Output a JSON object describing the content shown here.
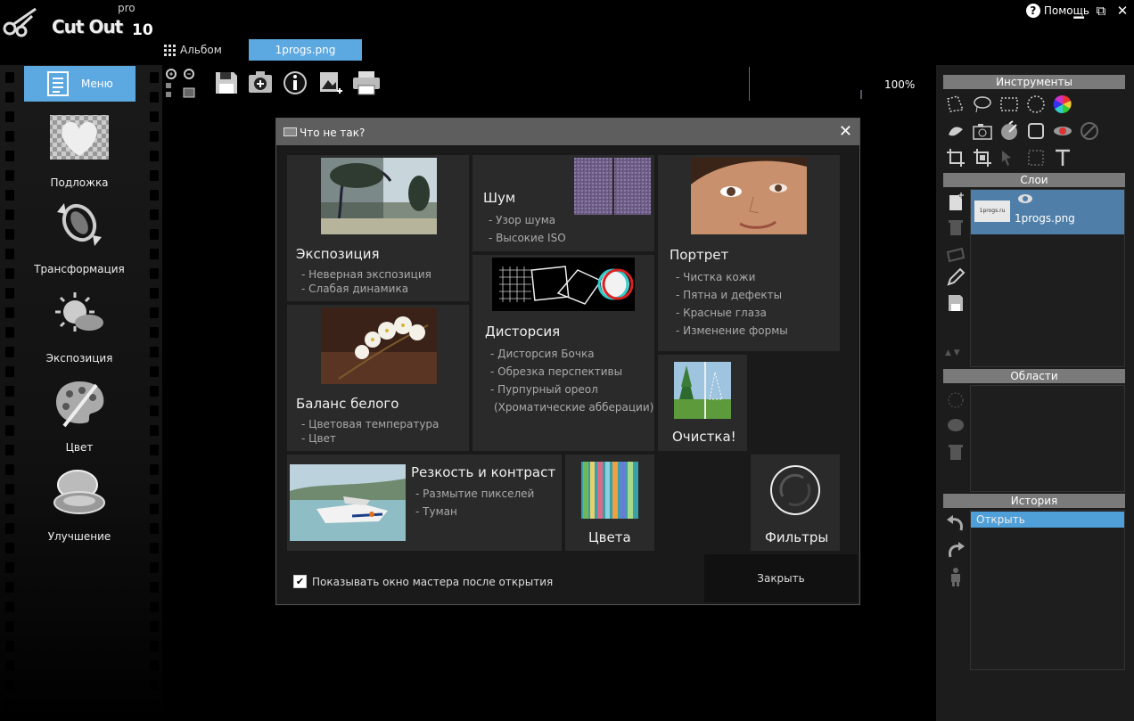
{
  "app": {
    "logo_text": "Cut Out",
    "logo_pro": "pro",
    "logo_version": "10"
  },
  "tabs": [
    {
      "label": "Альбом"
    },
    {
      "label": "1progs.png"
    }
  ],
  "window": {
    "help_label": "Помощь",
    "minimize": "▁",
    "maximize": "⧉",
    "close": "✕"
  },
  "sidebar": {
    "menu_label": "Меню",
    "items": [
      {
        "label": "Подложка",
        "icon": "heart-icon"
      },
      {
        "label": "Трансформация",
        "icon": "transform-icon"
      },
      {
        "label": "Экспозиция",
        "icon": "exposure-icon"
      },
      {
        "label": "Цвет",
        "icon": "palette-icon"
      },
      {
        "label": "Улучшение",
        "icon": "compact-icon"
      }
    ]
  },
  "toolbar": {
    "zoom": "100%",
    "icons": [
      "zoom-in-icon",
      "zoom-out-icon",
      "save-icon",
      "add-icon",
      "info-icon",
      "export-icon",
      "print-icon"
    ]
  },
  "right": {
    "tools_header": "Инструменты",
    "layers_header": "Слои",
    "layer": {
      "name": "1progs.png",
      "thumb_text": "1progs.ru"
    },
    "areas_header": "Области",
    "history_header": "История",
    "history_items": [
      "Открыть"
    ]
  },
  "dialog": {
    "title": "Что не так?",
    "close_symbol": "✕",
    "tiles": {
      "exposure": {
        "title": "Экспозиция",
        "items": [
          "- Неверная экспозиция",
          "- Слабая динамика"
        ]
      },
      "noise": {
        "title": "Шум",
        "items": [
          "- Узор шума",
          "- Высокие ISO"
        ]
      },
      "portrait": {
        "title": "Портрет",
        "items": [
          "- Чистка кожи",
          "- Пятна и дефекты",
          "- Красные глаза",
          "- Изменение формы"
        ]
      },
      "distortion": {
        "title": "Дисторсия",
        "items": [
          "- Дисторсия Бочка",
          "- Обрезка перспективы",
          "- Пурпурный ореол",
          "(Хроматические абберации)"
        ]
      },
      "white_balance": {
        "title": "Баланс белого",
        "items": [
          "- Цветовая температура",
          "- Цвет"
        ]
      },
      "cleanup": {
        "title": "Очистка!"
      },
      "sharpness": {
        "title": "Резкость и контраст",
        "items": [
          "- Размытие пикселей",
          "- Туман"
        ]
      },
      "colors": {
        "title": "Цвета"
      },
      "filters": {
        "title": "Фильтры"
      }
    },
    "checkbox_label": "Показывать окно мастера после открытия",
    "checkbox_checked": true,
    "close_button": "Закрыть"
  }
}
